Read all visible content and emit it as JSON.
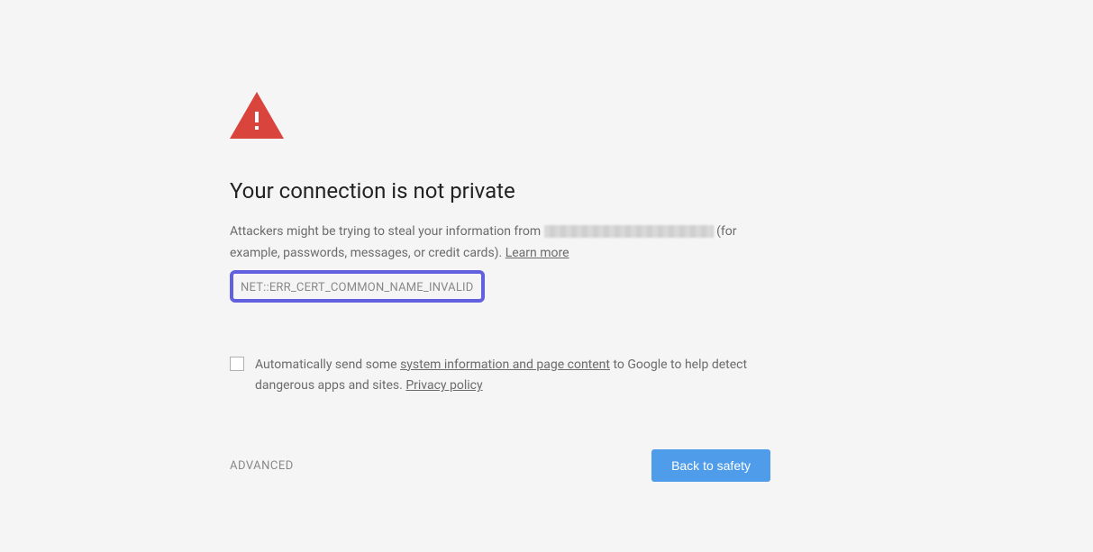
{
  "icon": {
    "name": "warning-triangle-icon",
    "fill": "#d9453d"
  },
  "heading": "Your connection is not private",
  "body": {
    "prefix": "Attackers might be trying to steal your information from ",
    "suffix": " (for example, passwords, messages, or credit cards). ",
    "learn_more": "Learn more"
  },
  "error_code": "NET::ERR_CERT_COMMON_NAME_INVALID",
  "opt_in": {
    "prefix": "Automatically send some ",
    "link1": "system information and page content",
    "middle": " to Google to help detect dangerous apps and sites. ",
    "link2": "Privacy policy"
  },
  "actions": {
    "advanced": "ADVANCED",
    "back": "Back to safety"
  }
}
